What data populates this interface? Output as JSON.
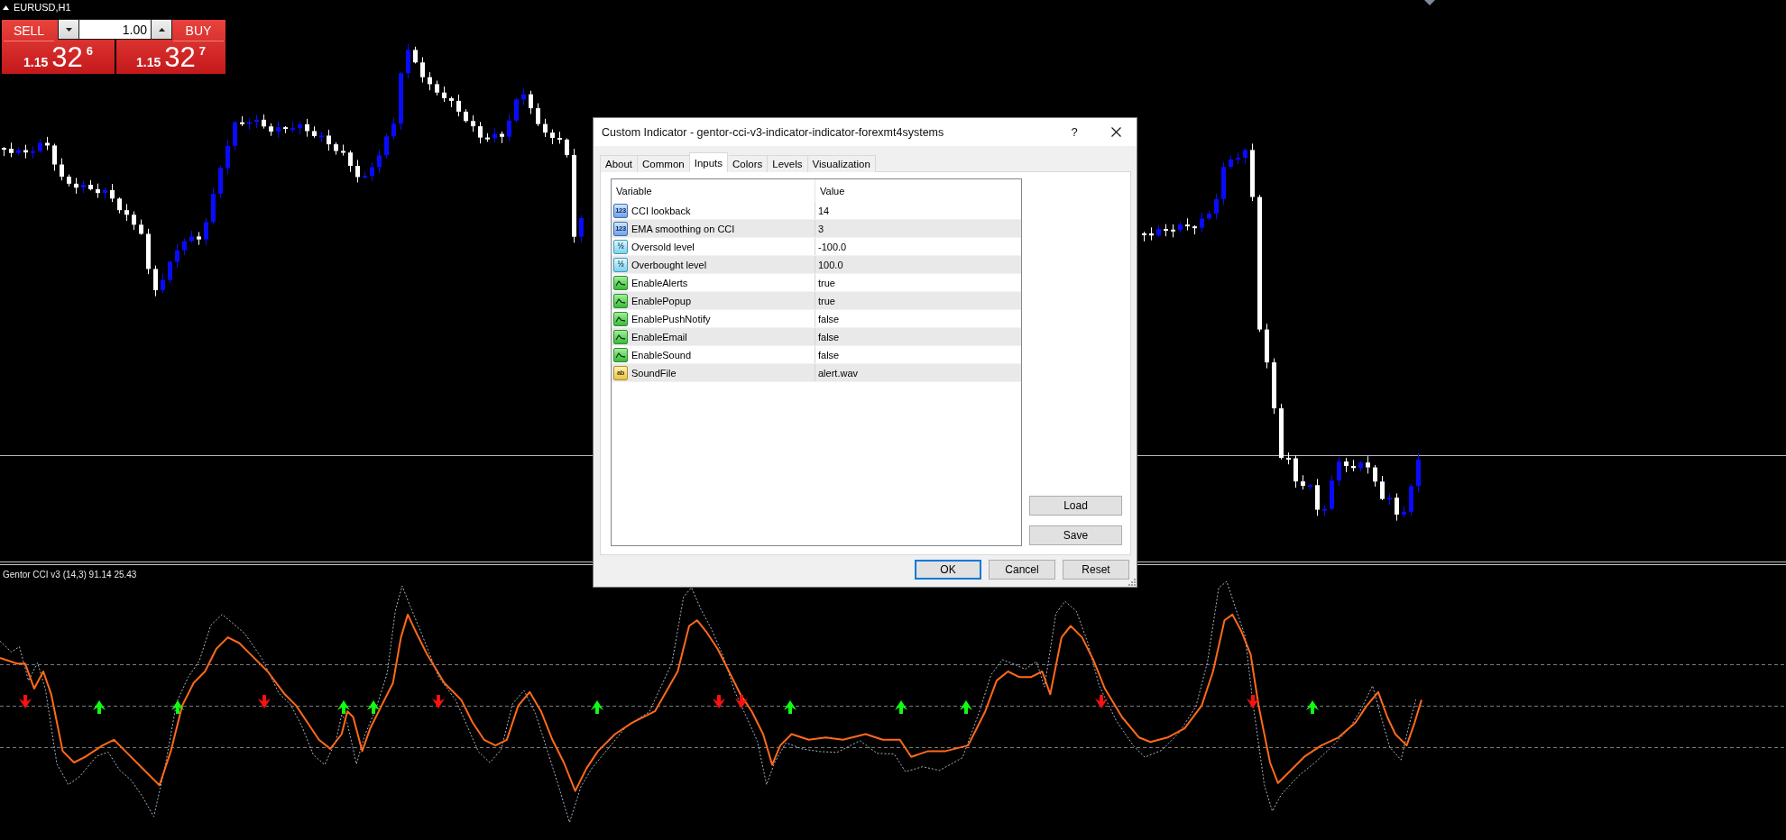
{
  "chart": {
    "symbol": "EURUSD,H1"
  },
  "trade_panel": {
    "sell": {
      "label": "SELL",
      "price": {
        "prefix": "1.15",
        "pips": "32",
        "fraction": "6"
      }
    },
    "volume": "1.00",
    "buy": {
      "label": "BUY",
      "price": {
        "prefix": "1.15",
        "pips": "32",
        "fraction": "7"
      }
    }
  },
  "indicator": {
    "label": "Gentor CCI v3 (14,3) 91.14 25.43"
  },
  "dialog": {
    "title": "Custom Indicator - gentor-cci-v3-indicator-indicator-forexmt4systems",
    "help": "?",
    "tabs": [
      {
        "label": "About",
        "selected": false
      },
      {
        "label": "Common",
        "selected": false
      },
      {
        "label": "Inputs",
        "selected": true
      },
      {
        "label": "Colors",
        "selected": false
      },
      {
        "label": "Levels",
        "selected": false
      },
      {
        "label": "Visualization",
        "selected": false
      }
    ],
    "table": {
      "columns": [
        "Variable",
        "Value"
      ],
      "rows": [
        {
          "kind": "int",
          "badge": "123",
          "variable": "CCI lookback",
          "value": "14"
        },
        {
          "kind": "int",
          "badge": "123",
          "variable": "EMA smoothing on CCI",
          "value": "3"
        },
        {
          "kind": "double",
          "badge": "½",
          "variable": "Oversold level",
          "value": "-100.0"
        },
        {
          "kind": "double",
          "badge": "½",
          "variable": "Overbought level",
          "value": "100.0"
        },
        {
          "kind": "bool",
          "variable": "EnableAlerts",
          "value": "true"
        },
        {
          "kind": "bool",
          "variable": "EnablePopup",
          "value": "true"
        },
        {
          "kind": "bool",
          "variable": "EnablePushNotify",
          "value": "false"
        },
        {
          "kind": "bool",
          "variable": "EnableEmail",
          "value": "false"
        },
        {
          "kind": "bool",
          "variable": "EnableSound",
          "value": "false"
        },
        {
          "kind": "string",
          "badge": "ab",
          "variable": "SoundFile",
          "value": "alert.wav"
        }
      ]
    },
    "side_buttons": [
      "Load",
      "Save"
    ],
    "buttons": [
      {
        "label": "OK",
        "default": true
      },
      {
        "label": "Cancel",
        "default": false
      },
      {
        "label": "Reset",
        "default": false
      }
    ]
  }
}
